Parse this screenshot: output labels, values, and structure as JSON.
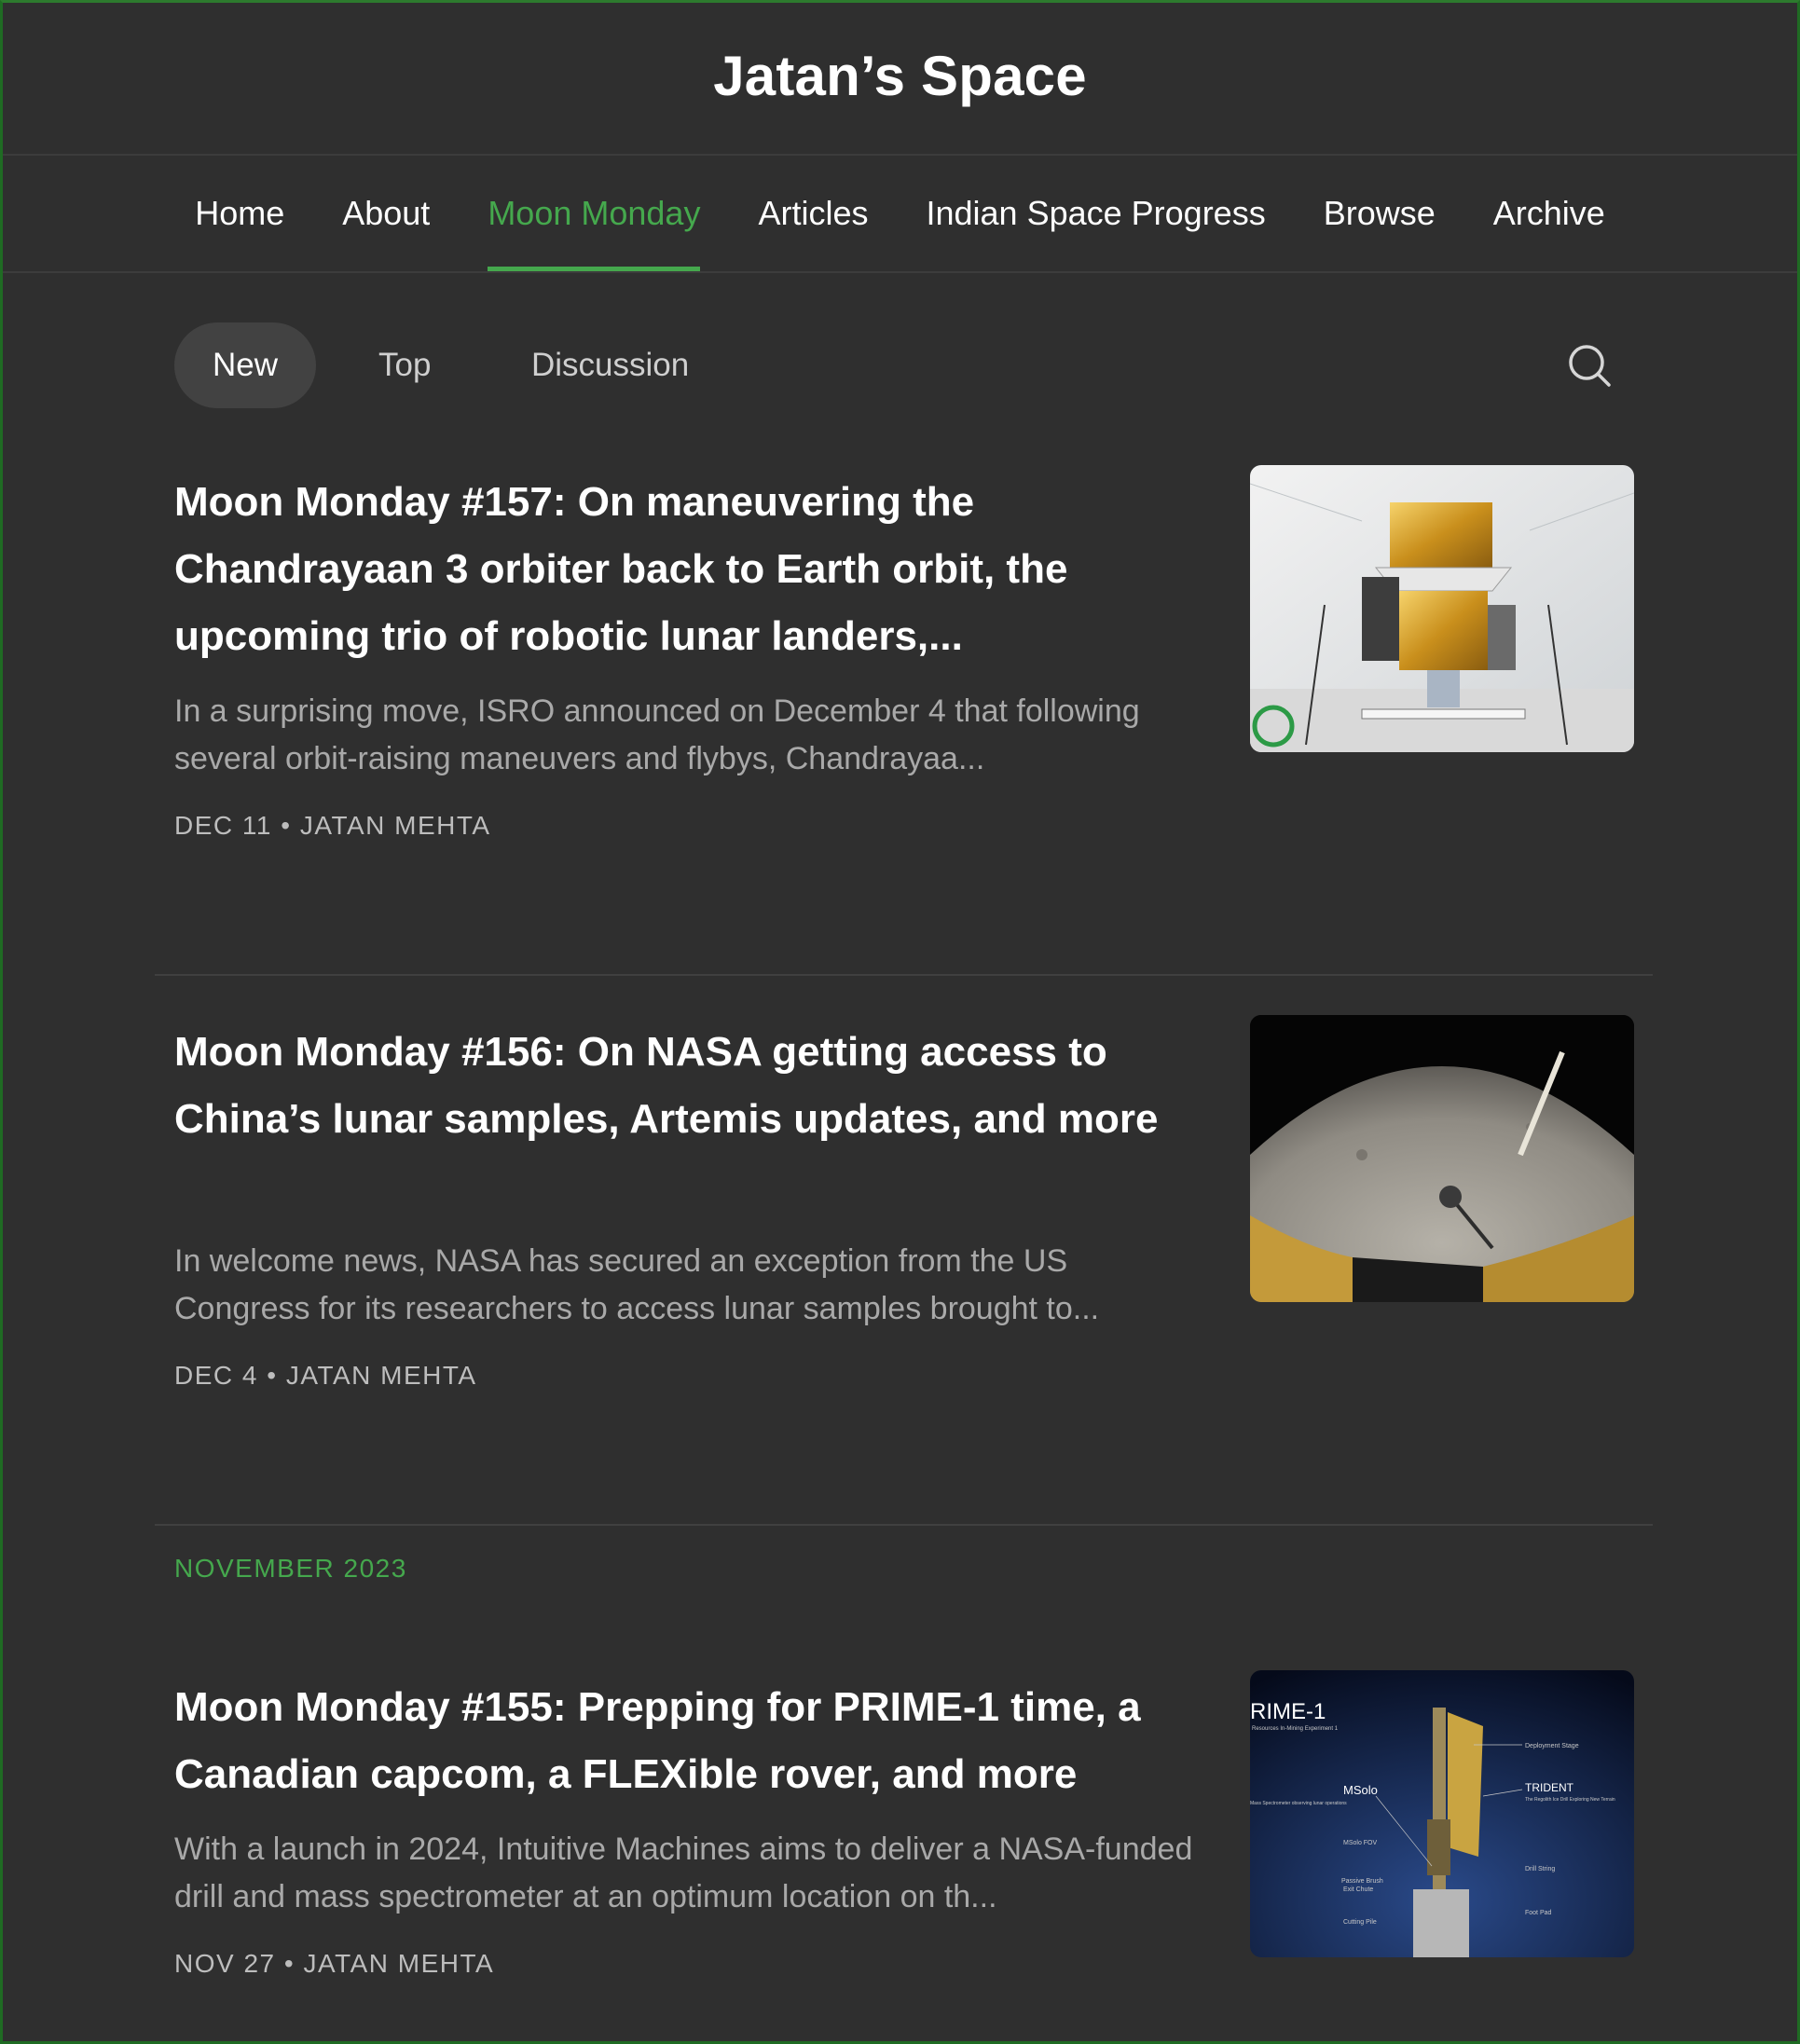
{
  "site": {
    "title": "Jatan’s Space"
  },
  "nav": {
    "items": [
      {
        "label": "Home"
      },
      {
        "label": "About"
      },
      {
        "label": "Moon Monday"
      },
      {
        "label": "Articles"
      },
      {
        "label": "Indian Space Progress"
      },
      {
        "label": "Browse"
      },
      {
        "label": "Archive"
      }
    ],
    "active": "Moon Monday"
  },
  "filters": {
    "items": [
      {
        "label": "New"
      },
      {
        "label": "Top"
      },
      {
        "label": "Discussion"
      }
    ],
    "active": "New",
    "search_icon": "search-icon"
  },
  "posts": [
    {
      "title": "Moon Monday #157: On maneuvering the Chandrayaan 3 orbiter back to Earth orbit, the upcoming trio of robotic lunar landers,...",
      "excerpt": "In a surprising move, ISRO announced on December 4 that following several orbit-raising maneuvers and flybys, Chandrayaa...",
      "date": "DEC 11",
      "separator": "•",
      "author": "JATAN MEHTA",
      "thumbnail": "spacecraft-in-cleanroom-image"
    },
    {
      "title": "Moon Monday #156: On NASA getting access to China’s lunar samples, Artemis updates, and more",
      "excerpt": "In welcome news, NASA has secured an exception from the US Congress for its researchers to access lunar samples brought to...",
      "date": "DEC 4",
      "separator": "•",
      "author": "JATAN MEHTA",
      "thumbnail": "lunar-surface-image"
    },
    {
      "title": "Moon Monday #155: Prepping for PRIME-1 time, a Canadian capcom, a FLEXible rover, and more",
      "excerpt": "With a launch in 2024, Intuitive Machines aims to deliver a NASA-funded drill and mass spectrometer at an optimum location on th...",
      "date": "NOV 27",
      "separator": "•",
      "author": "JATAN MEHTA",
      "thumbnail": "prime-1-diagram-image",
      "thumb_text": {
        "title": "RIME-1",
        "subtitle": "Resources In-Mining Experiment 1",
        "msolo": "MSolo",
        "msolo_sub": "Mass Spectrometer observing lunar operations",
        "trident": "TRIDENT",
        "trident_sub": "The Regolith Ice Drill Exploring New Terrain",
        "deployment": "Deployment Stage",
        "msolo_fov": "MSolo FOV",
        "brush": "Passive Brush",
        "chute": "Exit Chute",
        "pile": "Cutting Pile",
        "drill_string": "Drill String",
        "foot_pad": "Foot Pad"
      }
    }
  ],
  "month_label": "NOVEMBER 2023",
  "colors": {
    "background": "#2f2f2f",
    "accent": "#45a84d",
    "border": "#1f6b23",
    "text": "#ffffff",
    "muted": "#a9a9a9"
  }
}
